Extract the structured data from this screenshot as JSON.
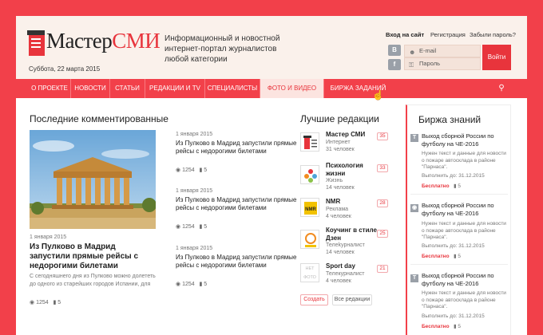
{
  "header": {
    "logo": "МастерСМИ",
    "logo_part1": "Мастер",
    "logo_part2": "СМИ",
    "date": "Суббота, 22 марта 2015",
    "tagline": "Информационный и новостной интернет-портал журналистов любой категории",
    "login_title": "Вход на сайт",
    "register": "Регистрация",
    "forgot": "Забыли пароль?",
    "email_placeholder": "E-mail",
    "password_placeholder": "Пароль",
    "login_button": "Войти",
    "social": [
      "В",
      "f"
    ]
  },
  "nav": {
    "items": [
      "О ПРОЕКТЕ",
      "НОВОСТИ",
      "СТАТЬИ",
      "РЕДАКЦИИ И TV",
      "СПЕЦИАЛИСТЫ",
      "ФОТО И ВИДЕО",
      "БИРЖА ЗАДАНИЙ"
    ],
    "active_index": 5
  },
  "commented": {
    "title": "Последние комментированные",
    "hero": {
      "date": "1 января 2015",
      "title": "Из Пулково в Мадрид запустили прямые рейсы с недорогими билетами",
      "excerpt": "С сегодняшнего дня из Пулково можно долететь до одного из старейших городов Испании, для",
      "views": "1254",
      "comments": "5"
    },
    "articles": [
      {
        "date": "1 января 2015",
        "title": "Из Пулково в Мадрид запустили прямые рейсы с недорогими билетами",
        "views": "1254",
        "comments": "5"
      },
      {
        "date": "1 января 2015",
        "title": "Из Пулково в Мадрид запустили прямые рейсы с недорогими билетами",
        "views": "1254",
        "comments": "5"
      },
      {
        "date": "1 января 2015",
        "title": "Из Пулково в Мадрид запустили прямые рейсы с недорогими билетами",
        "views": "1254",
        "comments": "5"
      }
    ]
  },
  "editors": {
    "title": "Лучшие редакции",
    "items": [
      {
        "name": "Мастер СМИ",
        "category": "Интернет",
        "members": "31 человек",
        "rank": "35"
      },
      {
        "name": "Психология жизни",
        "category": "Жизнь",
        "members": "14 человек",
        "rank": "33"
      },
      {
        "name": "NMR",
        "category": "Реклама",
        "members": "4 человек",
        "rank": "28"
      },
      {
        "name": "Коучинг в стиле Дзен",
        "category": "Телеkурналист",
        "members": "14 человек",
        "rank": "25"
      },
      {
        "name": "Sport day",
        "category": "Телекурналист",
        "members": "4 человек",
        "rank": "21"
      }
    ],
    "no_photo": "НЕТ ФОТО",
    "create_button": "Создать",
    "all_button": "Все редакции"
  },
  "exchange": {
    "title": "Биржа знаний",
    "items": [
      {
        "icon": "T",
        "title": "Выход сборной России по футболу на ЧЕ-2016",
        "desc": "Нужен текст и данные для новости о пожаре автосклада в районе \"Парнаса\".",
        "deadline": "Выполнить до: 31.12.2015",
        "price": "Бесплатно",
        "comments": "5"
      },
      {
        "icon": "camera",
        "title": "Выход сборной России по футболу на ЧЕ-2016",
        "desc": "Нужен текст и данные для новости о пожаре автосклада в районе \"Парнаса\".",
        "deadline": "Выполнить до: 31.12.2015",
        "price": "Бесплатно",
        "comments": "5"
      },
      {
        "icon": "T",
        "title": "Выход сборной России по футболу на ЧЕ-2016",
        "desc": "Нужен текст и данные для новости о пожаре автосклада в районе \"Парнаса\".",
        "deadline": "Выполнить до: 31.12.2015",
        "price": "Бесплатно",
        "comments": "5"
      }
    ]
  },
  "colors": {
    "accent": "#f2404a",
    "header_bg": "#faf1eb",
    "nav_active": "#fce4e0"
  }
}
